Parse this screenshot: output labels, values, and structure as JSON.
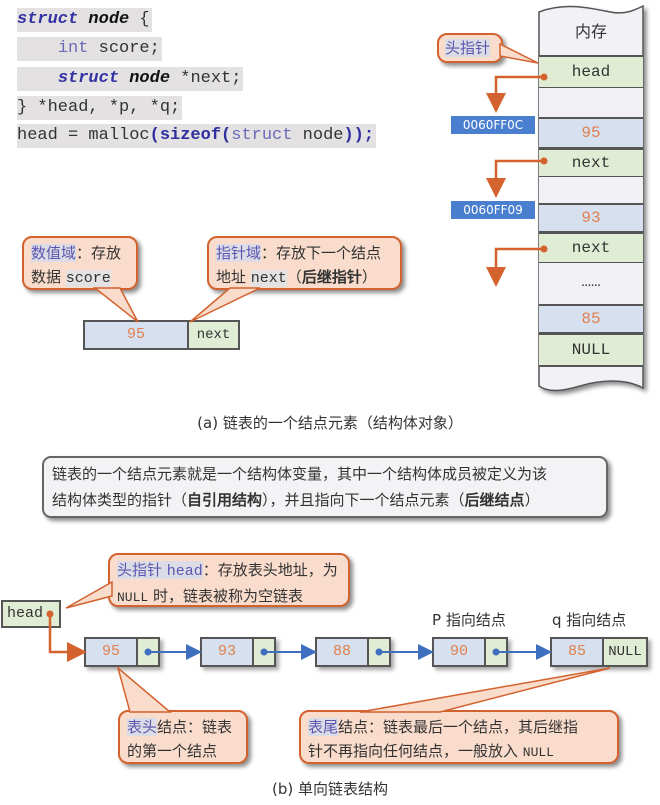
{
  "code": {
    "line1": {
      "kw": "struct",
      "name": "node",
      "brace": " {"
    },
    "line2": {
      "type": "int",
      "rest": " score;"
    },
    "line3": {
      "kw": "struct",
      "name": "node",
      "rest": " *next;"
    },
    "line4": {
      "text": "} *head, *p, *q;"
    },
    "line5": {
      "pre": "head = malloc",
      "p1": "(",
      "fn": "sizeof",
      "p2": "(",
      "type": "struct",
      "mid": " node",
      "p3": "));"
    }
  },
  "memory": {
    "title": "内存",
    "callout": "头指针",
    "cells": [
      {
        "text": "head",
        "kind": "pointer"
      },
      {
        "text": "",
        "kind": "empty"
      },
      {
        "text": "95",
        "kind": "value"
      },
      {
        "text": "next",
        "kind": "pointer"
      },
      {
        "text": "",
        "kind": "empty"
      },
      {
        "text": "93",
        "kind": "value"
      },
      {
        "text": "next",
        "kind": "pointer"
      },
      {
        "text": "……",
        "kind": "empty"
      },
      {
        "text": "85",
        "kind": "value"
      },
      {
        "text": "NULL",
        "kind": "pointer"
      }
    ],
    "addresses": [
      "0060FF0C",
      "0060FF09"
    ]
  },
  "part_a": {
    "value_callout": {
      "hl": "数值域",
      "text1": "：存放",
      "text2": "数据 ",
      "code": "score"
    },
    "pointer_callout": {
      "hl": "指针域",
      "text1": "：存放下一个结点",
      "text2": "地址 ",
      "code": "next",
      "paren_open": "（",
      "bold": "后继指针",
      "paren_close": "）"
    },
    "node": {
      "value": "95",
      "pointer": "next"
    },
    "caption": "(a) 链表的一个结点元素（结构体对象）"
  },
  "info_box": {
    "line1": "链表的一个结点元素就是一个结构体变量，其中一个结构体成员被定义为该",
    "line2_a": "结构体类型的指针（",
    "line2_b": "自引用结构",
    "line2_c": "），并且指向下一个结点元素（",
    "line2_d": "后继结点",
    "line2_e": "）"
  },
  "part_b": {
    "head_label": "head",
    "head_callout": {
      "hl": "头指针 ",
      "code": "head",
      "text1": "：存放表头地址，为",
      "code2": "NULL",
      "text2": " 时，链表被称为空链表"
    },
    "nodes": [
      {
        "value": "95",
        "pointer": ""
      },
      {
        "value": "93",
        "pointer": ""
      },
      {
        "value": "88",
        "pointer": ""
      },
      {
        "value": "90",
        "pointer": ""
      },
      {
        "value": "85",
        "pointer": "NULL"
      }
    ],
    "p_label": "P 指向结点",
    "q_label": "q 指向结点",
    "head_node_callout": {
      "hl": "表头",
      "text1": "结点：链表",
      "text2": "的第一个结点"
    },
    "tail_node_callout": {
      "hl": "表尾",
      "text1": "结点：链表最后一个结点，其后继指",
      "text2": "针不再指向任何结点，一般放入 ",
      "code": "NULL"
    },
    "caption": "(b) 单向链表结构"
  },
  "colors": {
    "arrow_orange": "#d3622e",
    "arrow_blue": "#3f6fbf",
    "value_fill": "#d6e0ee",
    "pointer_fill": "#e0ecd4",
    "callout_fill": "#f9dccc",
    "address_fill": "#4a7fd0"
  }
}
